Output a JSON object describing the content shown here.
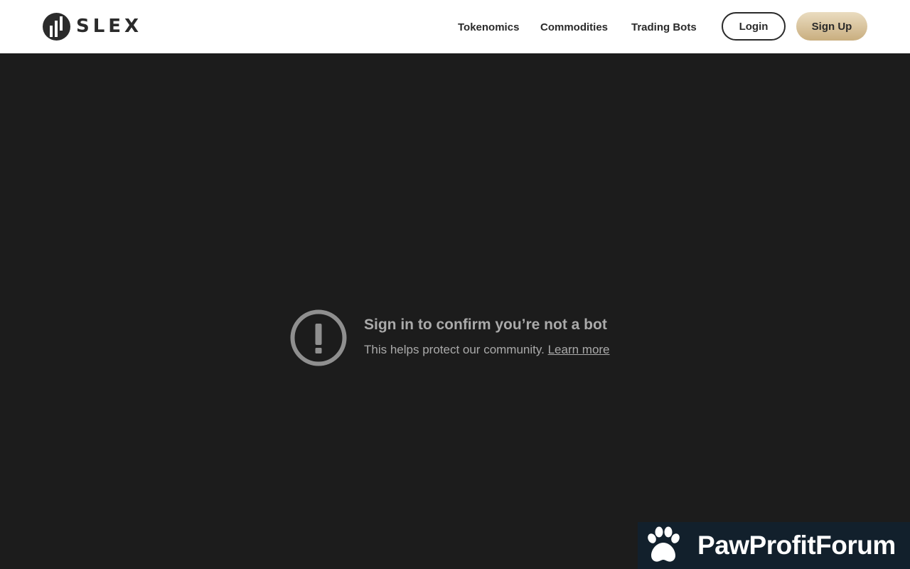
{
  "header": {
    "brand": "SLEX",
    "nav": [
      "Tokenomics",
      "Commodities",
      "Trading Bots"
    ],
    "login_label": "Login",
    "signup_label": "Sign Up"
  },
  "notice": {
    "title": "Sign in to confirm you’re not a bot",
    "subtitle": "This helps protect our community.",
    "link": "Learn more",
    "icon": "alert-icon"
  },
  "watermark": {
    "text": "PawProfitForum",
    "icon": "paw-icon"
  },
  "colors": {
    "header_bg": "#ffffff",
    "page_bg": "#1c1c1c",
    "notice_text": "#aaaaaa",
    "signup_gold": "#c9ae7f",
    "watermark_bg": "#12202c"
  }
}
